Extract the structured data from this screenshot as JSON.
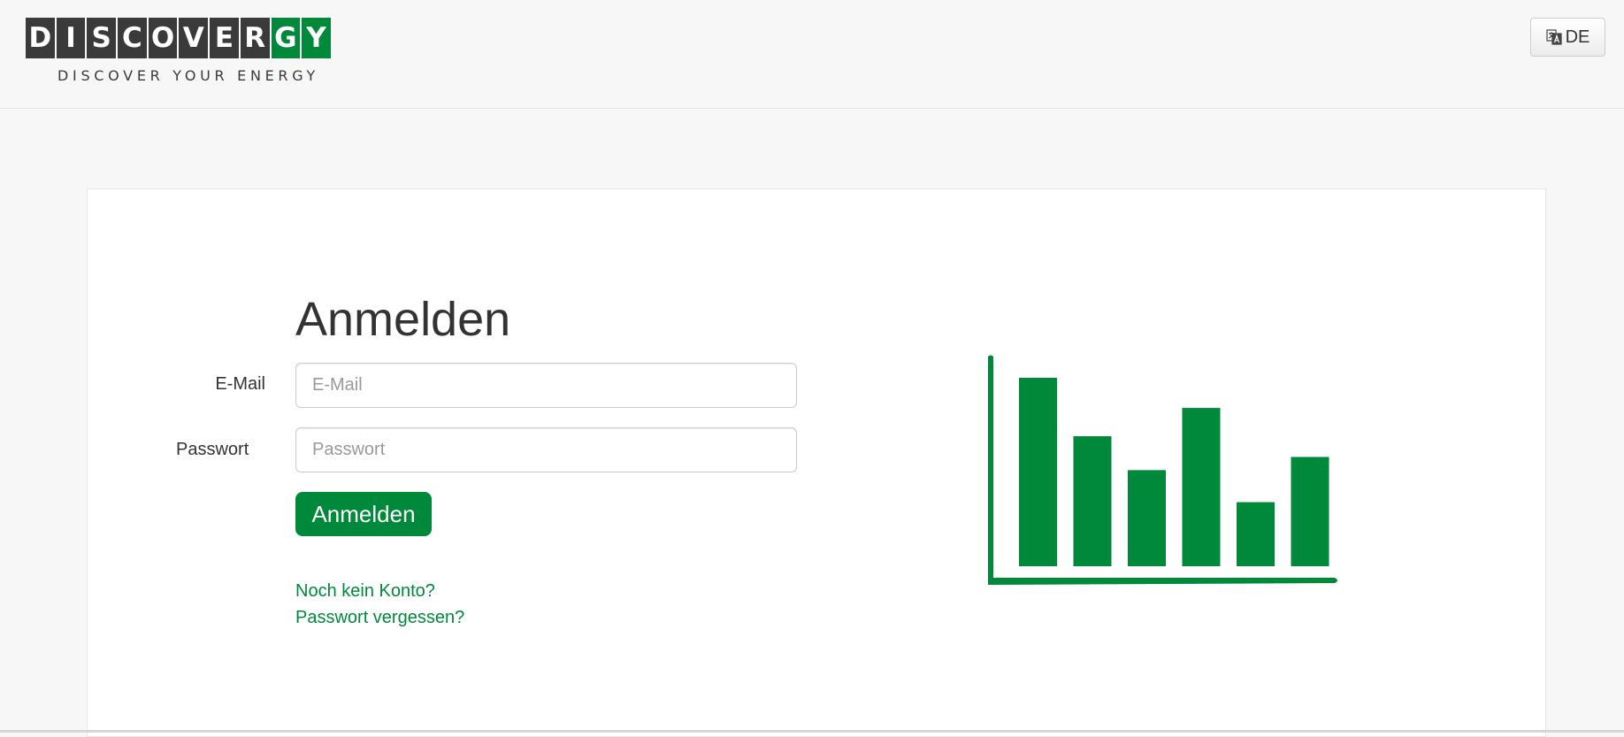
{
  "header": {
    "logo_letters": [
      "D",
      "I",
      "S",
      "C",
      "O",
      "V",
      "E",
      "R",
      "G",
      "Y"
    ],
    "logo_green_letters": [
      "G",
      "Y"
    ],
    "logo_tagline": "DISCOVER YOUR ENERGY",
    "language_label": "DE",
    "language_icon": "translate-icon"
  },
  "login": {
    "title": "Anmelden",
    "email_label": "E-Mail",
    "email_placeholder": "E-Mail",
    "email_value": "",
    "password_label": "Passwort",
    "password_placeholder": "Passwort",
    "password_value": "",
    "submit_label": "Anmelden",
    "register_link": "Noch kein Konto?",
    "forgot_link": "Passwort vergessen?"
  },
  "illustration": {
    "icon": "bar-chart-icon",
    "bar_levels": [
      1.0,
      0.69,
      0.51,
      0.84,
      0.34,
      0.58
    ]
  },
  "colors": {
    "brand_green": "#00893b",
    "logo_dark": "#3a3a3a",
    "page_background": "#f7f7f7",
    "card_background": "#ffffff"
  }
}
